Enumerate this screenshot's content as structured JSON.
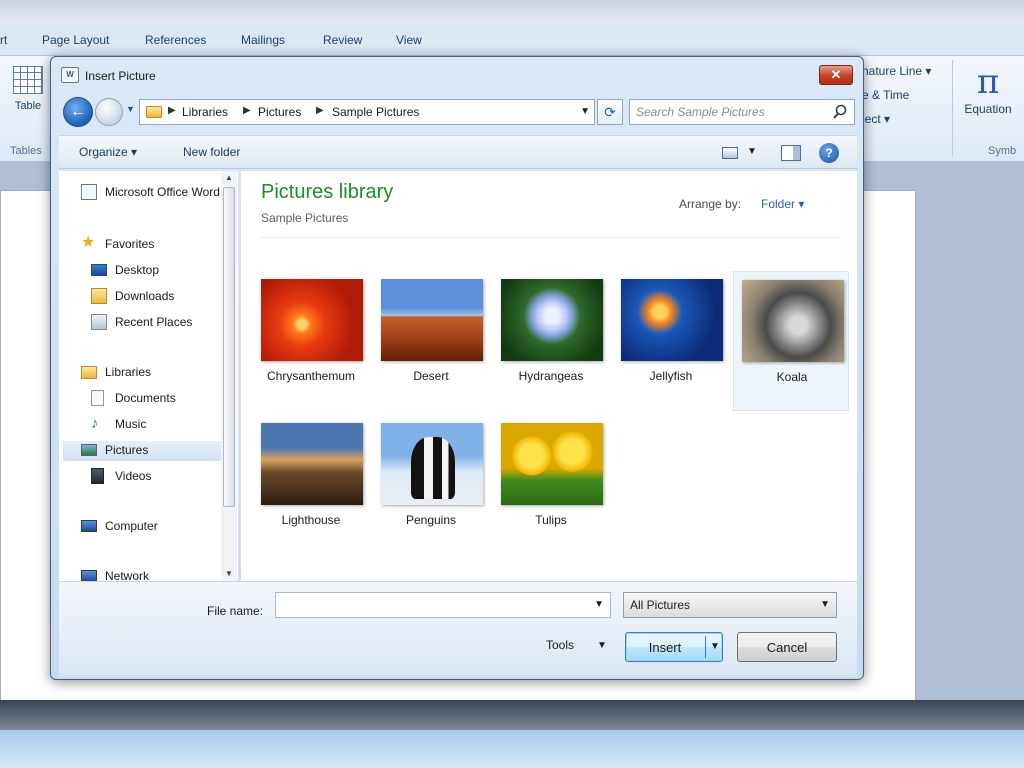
{
  "word": {
    "tabs": [
      "rt",
      "Page Layout",
      "References",
      "Mailings",
      "Review",
      "View"
    ],
    "table_label": "Table",
    "tables_group": "Tables",
    "right_items": [
      "nature Line ▾",
      "e & Time",
      "ject ▾"
    ],
    "equation_symbol": "π",
    "equation_label": "Equation",
    "symbols_group": "Symb"
  },
  "dialog": {
    "title": "Insert Picture",
    "close_glyph": "✕",
    "back_glyph": "←",
    "breadcrumb": [
      "Libraries",
      "Pictures",
      "Sample Pictures"
    ],
    "refresh_glyph": "⟳",
    "search_placeholder": "Search Sample Pictures",
    "toolbar": {
      "organize": "Organize ▾",
      "new_folder": "New folder",
      "help": "?"
    },
    "nav": {
      "items": [
        {
          "label": "Microsoft Office Word",
          "icon": "word-doc-icon"
        },
        {
          "label": "Favorites",
          "icon": "star-icon"
        },
        {
          "label": "Desktop",
          "icon": "desktop-icon"
        },
        {
          "label": "Downloads",
          "icon": "downloads-icon"
        },
        {
          "label": "Recent Places",
          "icon": "recent-places-icon"
        },
        {
          "label": "Libraries",
          "icon": "libraries-icon"
        },
        {
          "label": "Documents",
          "icon": "documents-icon"
        },
        {
          "label": "Music",
          "icon": "music-icon"
        },
        {
          "label": "Pictures",
          "icon": "pictures-icon"
        },
        {
          "label": "Videos",
          "icon": "videos-icon"
        },
        {
          "label": "Computer",
          "icon": "computer-icon"
        },
        {
          "label": "Network",
          "icon": "network-icon"
        }
      ]
    },
    "content": {
      "title": "Pictures library",
      "subtitle": "Sample Pictures",
      "arrange_label": "Arrange by:",
      "arrange_value": "Folder ▾",
      "thumbnails": [
        {
          "name": "Chrysanthemum"
        },
        {
          "name": "Desert"
        },
        {
          "name": "Hydrangeas"
        },
        {
          "name": "Jellyfish"
        },
        {
          "name": "Koala"
        },
        {
          "name": "Lighthouse"
        },
        {
          "name": "Penguins"
        },
        {
          "name": "Tulips"
        }
      ]
    },
    "bottom": {
      "file_name_label": "File name:",
      "file_name_value": "",
      "filter": "All Pictures",
      "tools": "Tools",
      "insert": "Insert",
      "cancel": "Cancel"
    }
  }
}
